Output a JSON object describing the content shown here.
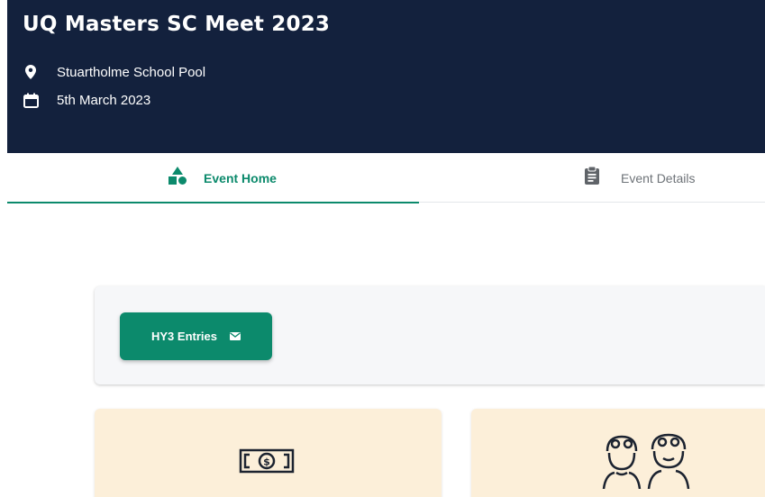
{
  "header": {
    "title": "UQ Masters SC Meet 2023",
    "location": "Stuartholme School Pool",
    "date": "5th March 2023"
  },
  "tabs": [
    {
      "label": "Event Home",
      "icon": "shapes-icon",
      "active": true
    },
    {
      "label": "Event Details",
      "icon": "clipboard-icon",
      "active": false
    }
  ],
  "entries": {
    "button_label": "HY3 Entries",
    "button_icon": "envelope-icon"
  },
  "cards": [
    {
      "icon": "money-icon"
    },
    {
      "icon": "swimmers-icon"
    }
  ],
  "colors": {
    "header_bg": "#13213d",
    "accent": "#0c8a6c",
    "card_bg": "#fcefd9",
    "panel_bg": "#f6f7f9"
  }
}
